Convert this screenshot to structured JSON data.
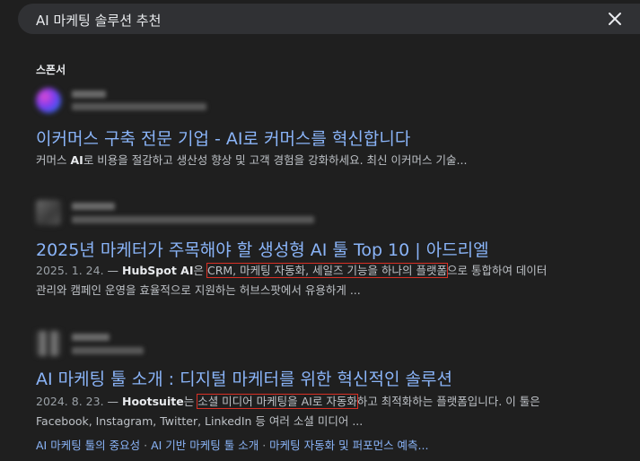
{
  "search": {
    "query": "AI 마케팅 솔루션 추천"
  },
  "sponsor_label": "스폰서",
  "results": [
    {
      "title": "이커머스 구축 전문 기업 - AI로 커머스를 혁신합니다",
      "snippet_pre": "커머스 ",
      "snippet_bold": "AI",
      "snippet_post": "로 비용을 절감하고 생산성 향상 및 고객 경험을 강화하세요. 최신 이커머스 기술..."
    },
    {
      "title": "2025년 마케터가 주목해야 할 생성형 AI 툴 Top 10 | 아드리엘",
      "date": "2025. 1. 24.",
      "dash": " — ",
      "snippet_bold": "HubSpot AI",
      "snippet_mid": "은 ",
      "snippet_highlight": "CRM, 마케팅 자동화, 세일즈 기능을 하나의 플랫폼",
      "snippet_post": "으로 통합하여 데이터",
      "snippet_line2": "관리와 캠페인 운영을 효율적으로 지원하는 허브스팟에서 유용하게 ..."
    },
    {
      "title": "AI 마케팅 툴 소개 : 디지털 마케터를 위한 혁신적인 솔루션",
      "date": "2024. 8. 23.",
      "dash": " — ",
      "snippet_bold": "Hootsuite",
      "snippet_mid": "는 ",
      "snippet_highlight": "소셜 미디어 마케팅을 AI로 자동화",
      "snippet_post": "하고 최적화하는 플랫폼입니다. 이 툴은",
      "snippet_line2": "Facebook, Instagram, Twitter, LinkedIn 등 여러 소셜 미디어 ...",
      "sitelinks": [
        "AI 마케팅 툴의 중요성",
        "AI 기반 마케팅 툴 소개",
        "마케팅 자동화 및 퍼포먼스 예측..."
      ],
      "sitelink_sep": " · "
    }
  ],
  "colors": {
    "background": "#1f1f1f",
    "link": "#8ab4f8",
    "highlight_box": "#d93025"
  },
  "icons": {
    "clear": "close-icon"
  }
}
